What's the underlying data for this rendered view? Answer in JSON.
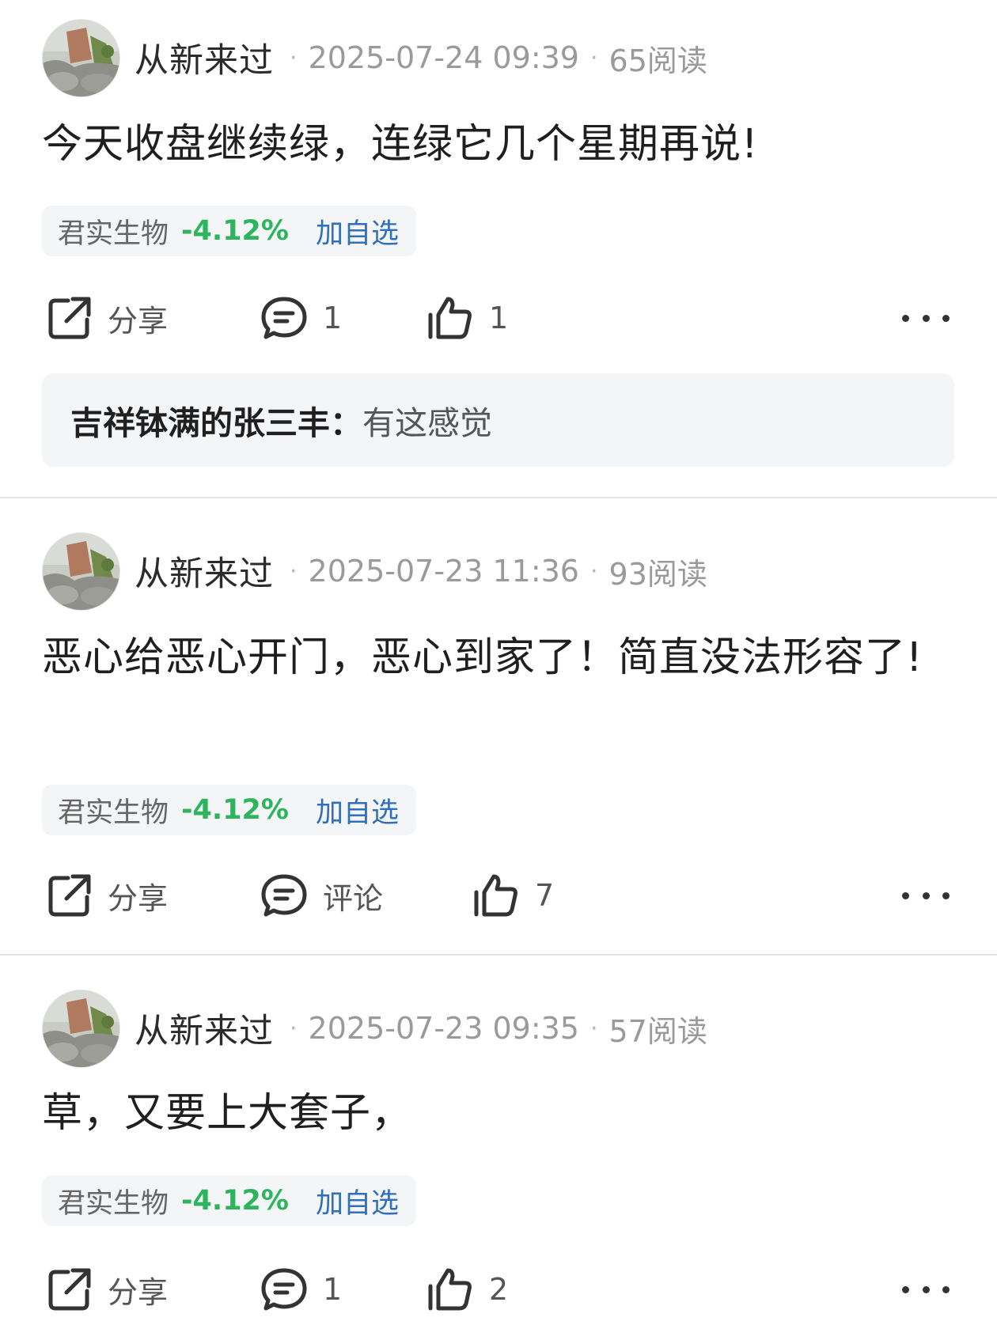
{
  "posts": [
    {
      "author": "从新来过",
      "date": "2025-07-24 09:39",
      "reads": "65阅读",
      "text": "今天收盘继续绿，连绿它几个星期再说!",
      "stock": {
        "name": "君实生物",
        "change": "-4.12%",
        "add": "加自选"
      },
      "actions": {
        "share": "分享",
        "comment": "1",
        "like": "1"
      },
      "reply": {
        "user": "吉祥钵满的张三丰：",
        "text": "有这感觉"
      }
    },
    {
      "author": "从新来过",
      "date": "2025-07-23 11:36",
      "reads": "93阅读",
      "text": "恶心给恶心开门，恶心到家了！简直没法形容了!",
      "stock": {
        "name": "君实生物",
        "change": "-4.12%",
        "add": "加自选"
      },
      "actions": {
        "share": "分享",
        "comment": "评论",
        "like": "7"
      }
    },
    {
      "author": "从新来过",
      "date": "2025-07-23 09:35",
      "reads": "57阅读",
      "text": "草，又要上大套子，",
      "stock": {
        "name": "君实生物",
        "change": "-4.12%",
        "add": "加自选"
      },
      "actions": {
        "share": "分享",
        "comment": "1",
        "like": "2"
      }
    }
  ],
  "colors": {
    "stock_change": "#2db45c",
    "add_link": "#2f70b8",
    "meta_text": "#9a9a9a",
    "tag_bg": "#f4f5f7"
  },
  "icons": {
    "share": "share-icon",
    "comment": "comment-icon",
    "like": "thumbs-up-icon",
    "more": "more-icon"
  }
}
